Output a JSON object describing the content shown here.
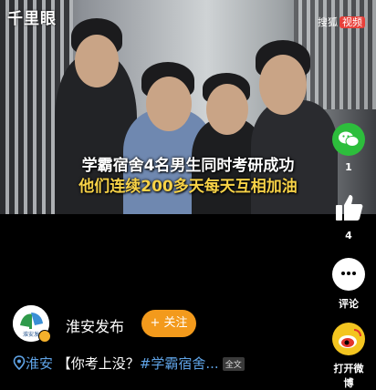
{
  "video": {
    "watermark_left": "千里眼",
    "watermark_right": "搜狐",
    "watermark_tag": "视频",
    "caption_line1": "学霸宿舍4名男生同时考研成功",
    "caption_line2": "他们连续200多天每天互相加油"
  },
  "actions": {
    "wechat": {
      "icon": "wechat-icon",
      "count": "1"
    },
    "like": {
      "icon": "thumbs-up-icon",
      "count": "4"
    },
    "comment": {
      "icon": "comment-icon",
      "label": "评论"
    },
    "weibo": {
      "icon": "weibo-icon",
      "label": "打开微博"
    }
  },
  "account": {
    "name": "淮安发布",
    "follow_label": "+ 关注",
    "avatar_text": "淮安发"
  },
  "post": {
    "location": "淮安",
    "text": "【你考上没？",
    "hashtag": "#学霸宿舍...",
    "fulltext_label": "全文"
  },
  "colors": {
    "follow": "#f39a1c",
    "wechat": "#2dbe3c",
    "weibo": "#f3c520",
    "link": "#5fa3e6",
    "caption_highlight": "#f7d247"
  }
}
